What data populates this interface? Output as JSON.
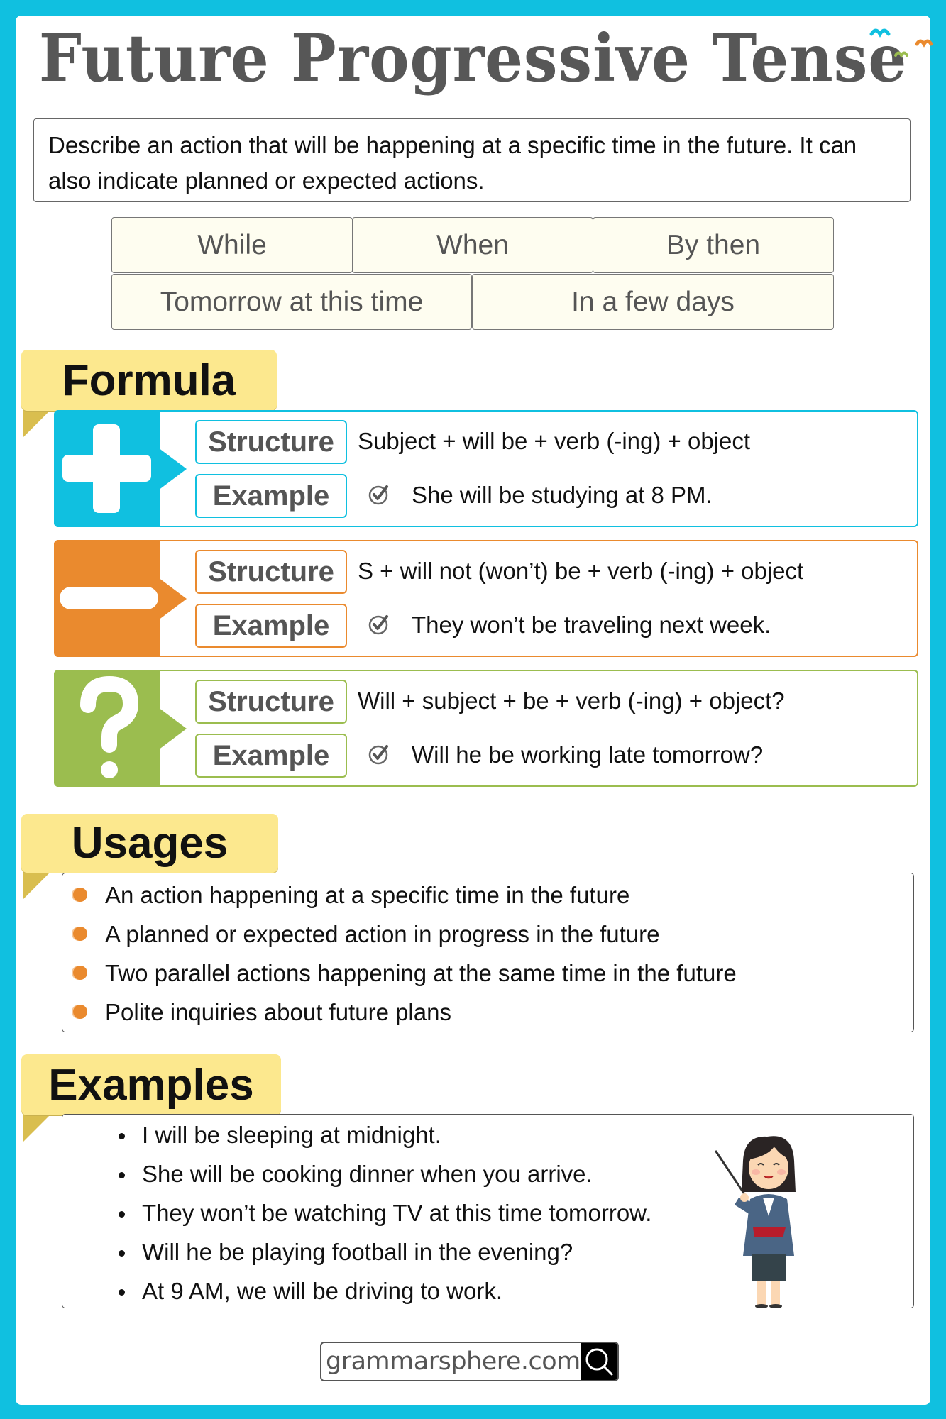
{
  "title": "Future Progressive Tense",
  "description": "Describe an action that will be happening at a specific time in the future. It can also indicate planned or expected actions.",
  "keywords": [
    "While",
    "When",
    "By then",
    "Tomorrow at this time",
    "In a few days"
  ],
  "colors": {
    "frame": "#10c0e0",
    "affirmative": "#10c0e0",
    "negative": "#ea8a2e",
    "interrogative": "#9bbd4f",
    "tab": "#fce88e",
    "bullet": "#ea8a2e"
  },
  "formula": {
    "heading": "Formula",
    "rows": [
      {
        "type": "affirmative",
        "icon": "plus-icon",
        "structure_label": "Structure",
        "example_label": "Example",
        "structure": "Subject + will be + verb (-ing) + object",
        "example": "She will be studying at 8 PM."
      },
      {
        "type": "negative",
        "icon": "minus-icon",
        "structure_label": "Structure",
        "example_label": "Example",
        "structure": "S + will not (won’t) be + verb (-ing) + object",
        "example": "They won’t be traveling next week."
      },
      {
        "type": "interrogative",
        "icon": "question-icon",
        "structure_label": "Structure",
        "example_label": "Example",
        "structure": "Will + subject + be + verb (-ing) + object?",
        "example": "Will he be working late tomorrow?"
      }
    ]
  },
  "usages": {
    "heading": "Usages",
    "items": [
      "An action happening at a specific time in the future",
      "A planned or expected action in progress in the future",
      "Two parallel actions happening at the same time in the future",
      "Polite inquiries about future plans"
    ]
  },
  "examples": {
    "heading": "Examples",
    "items": [
      "I will be sleeping at midnight.",
      "She will be cooking dinner when you arrive.",
      "They won’t be watching TV at this time tomorrow.",
      "Will he be playing football in the evening?",
      "At 9 AM, we will be driving to work."
    ],
    "illustration": "teacher-with-pointer"
  },
  "footer": {
    "site": "grammarsphere.com",
    "search_icon": "search-icon"
  }
}
